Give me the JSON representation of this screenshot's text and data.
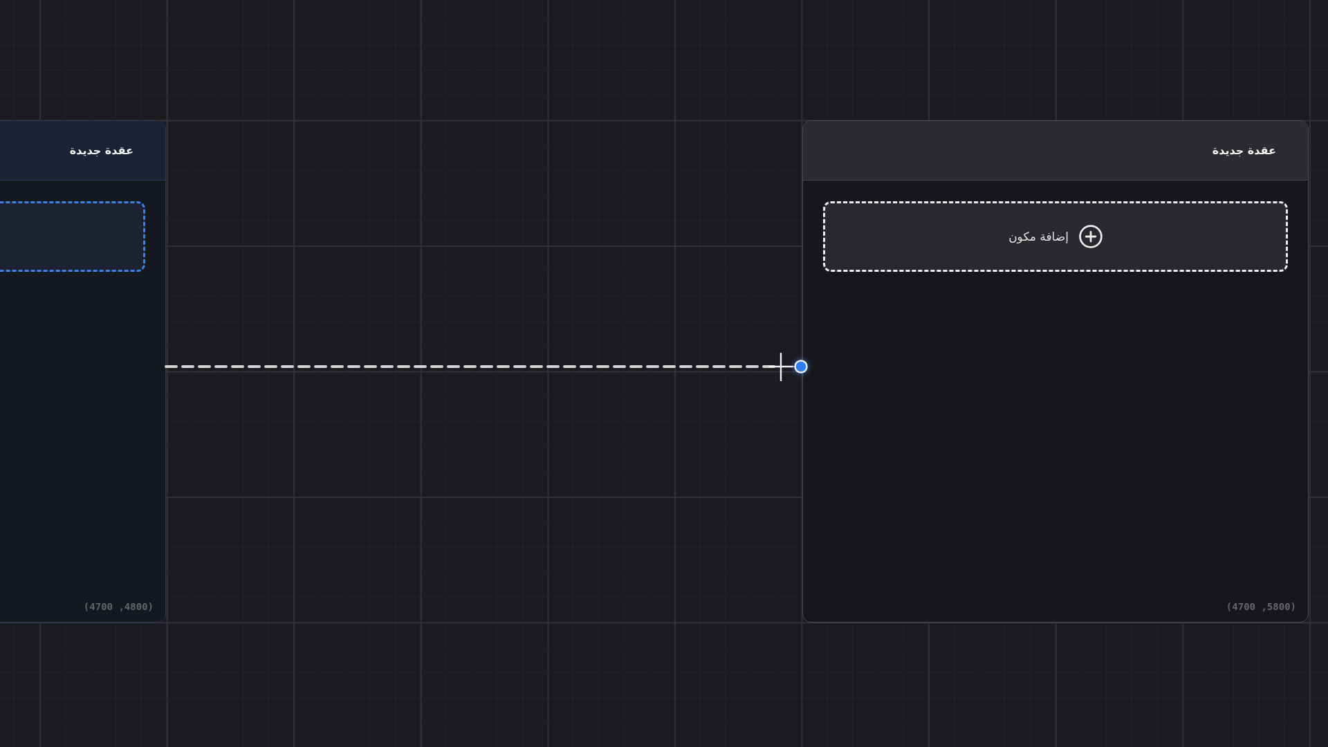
{
  "nodes": [
    {
      "title": "عقدة جديدة",
      "selected": false,
      "add_label": "إضافة مكون",
      "position": "(4700 ,5800)"
    },
    {
      "title": "عقدة جديدة",
      "selected": true,
      "position": "(4700 ,4800)"
    }
  ]
}
